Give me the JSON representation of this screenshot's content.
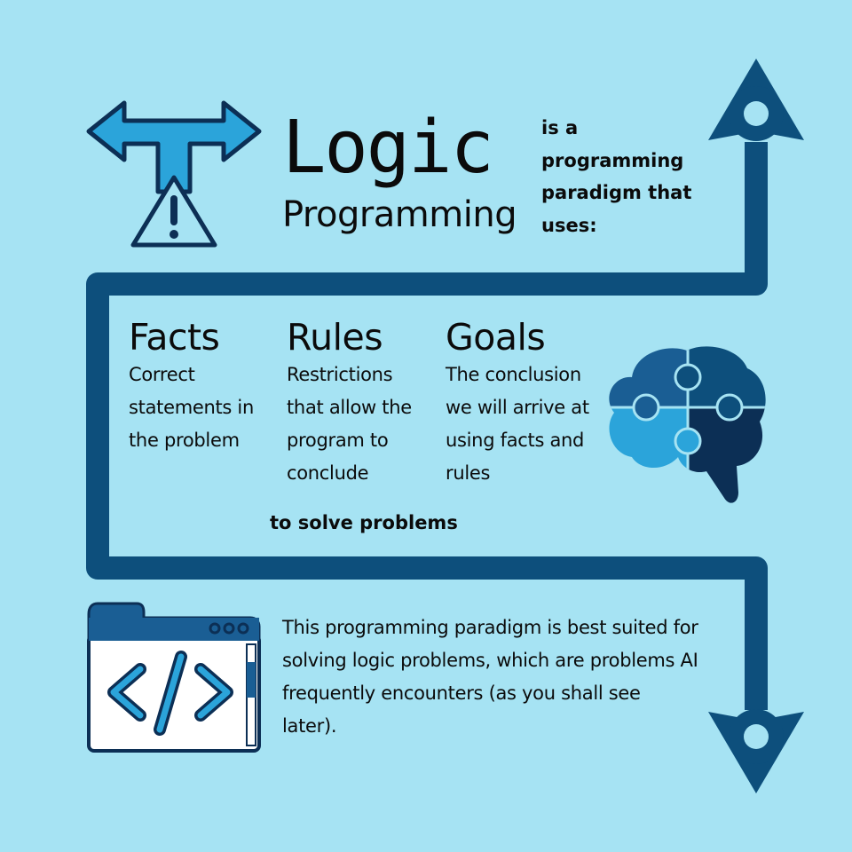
{
  "title": {
    "main": "Logic",
    "sub": "Programming"
  },
  "intro": "is a programming paradigm that uses:",
  "concepts": [
    {
      "heading": "Facts",
      "body": "Correct statements in the problem"
    },
    {
      "heading": "Rules",
      "body": "Restrictions that allow the program to conclude"
    },
    {
      "heading": "Goals",
      "body": "The conclusion we will arrive at using facts and rules"
    }
  ],
  "purpose": "to solve problems",
  "description": "This programming paradigm is best suited for solving logic problems, which are problems AI frequently encounters (as you shall see later).",
  "icons": {
    "decision": "split-arrow-warning-icon",
    "brain": "brain-puzzle-icon",
    "code": "code-window-icon",
    "path_start": "up-arrow-icon",
    "path_end": "down-arrow-icon"
  },
  "colors": {
    "background": "#a6e3f3",
    "path": "#0d4f7c",
    "accent": "#2ba4da",
    "dark": "#0c2f55",
    "text": "#0b0b0b"
  }
}
